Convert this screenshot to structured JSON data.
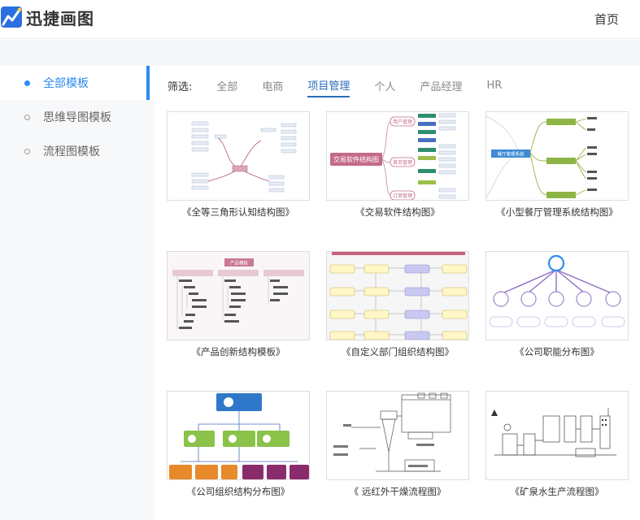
{
  "header": {
    "app_name": "迅捷画图",
    "home_link": "首页"
  },
  "sidebar": {
    "items": [
      {
        "label": "全部模板",
        "active": true
      },
      {
        "label": "思维导图模板",
        "active": false
      },
      {
        "label": "流程图模板",
        "active": false
      }
    ]
  },
  "filter": {
    "label": "筛选:",
    "tabs": [
      "全部",
      "电商",
      "项目管理",
      "个人",
      "产品经理",
      "HR"
    ],
    "active_tab": "项目管理"
  },
  "templates": [
    {
      "title": "《全等三角形认知结构图》"
    },
    {
      "title": "《交易软件结构图》",
      "center_label": "交易软件结构图",
      "nodes": [
        "用户管理",
        "首页管理",
        "订单管理"
      ]
    },
    {
      "title": "《小型餐厅管理系统结构图》",
      "center_label": "餐厅管理系统"
    },
    {
      "title": "《产品创新结构模板》",
      "top_label": "产品模板"
    },
    {
      "title": "《自定义部门组织结构图》"
    },
    {
      "title": "《公司职能分布图》"
    },
    {
      "title": "《公司组织结构分布图》"
    },
    {
      "title": "《 远红外干燥流程图》"
    },
    {
      "title": "《矿泉水生产流程图》"
    }
  ],
  "colors": {
    "accent": "#2b8cf0",
    "active_filter": "#2b6fb8",
    "sidebar_bg": "#f7f8fa"
  }
}
